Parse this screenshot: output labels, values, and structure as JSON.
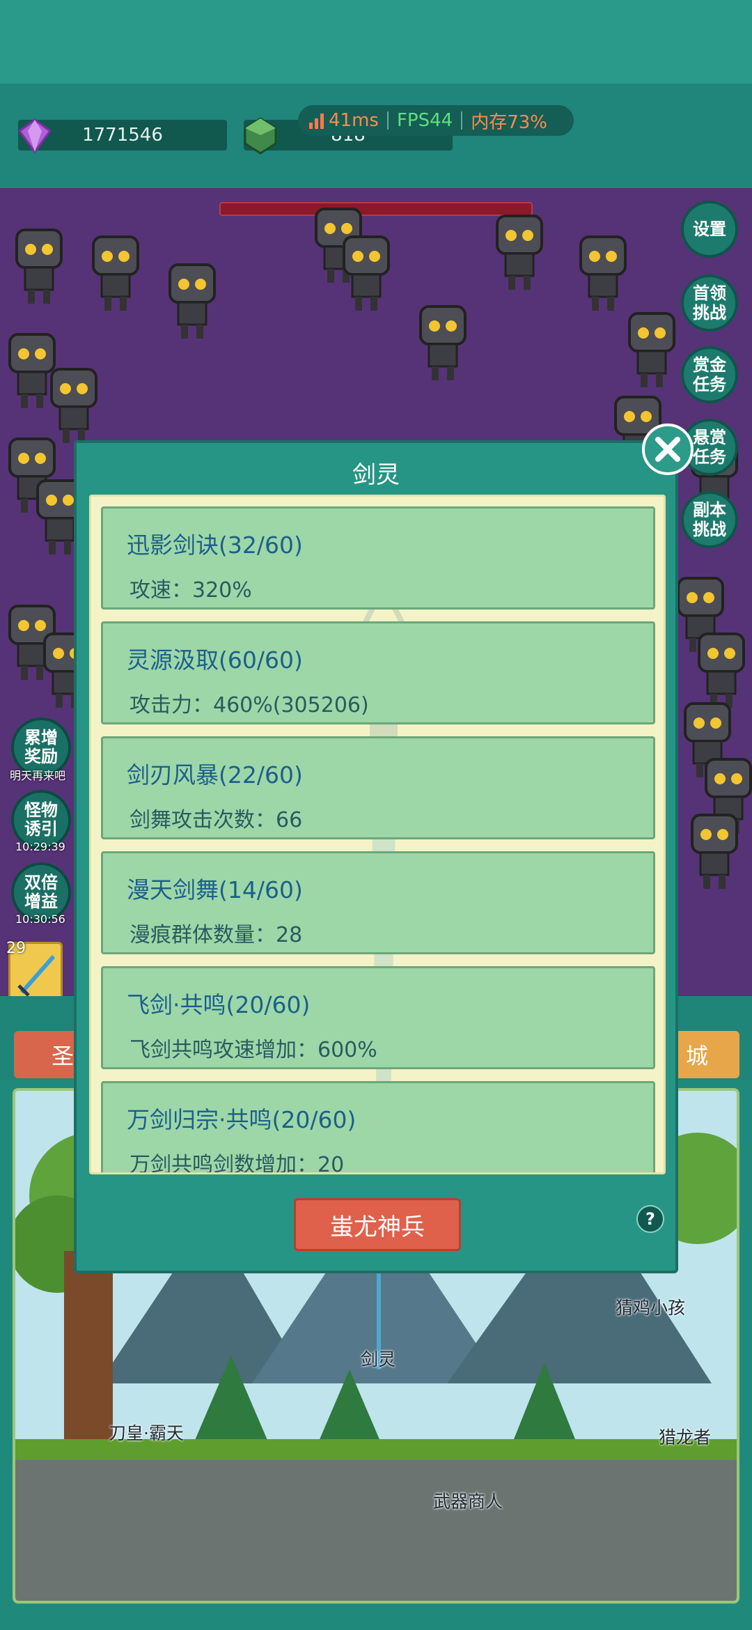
{
  "resources": {
    "gems": "1771546",
    "ore": "818"
  },
  "perf": {
    "latency": "41ms",
    "fps": "FPS44",
    "memory": "内存73%"
  },
  "right_menu": [
    "设置",
    "首领\n挑战",
    "赏金\n任务",
    "悬赏\n任务",
    "副本\n挑战"
  ],
  "left_menu": [
    {
      "label": "累增\n奖励",
      "note": "明天再来吧"
    },
    {
      "label": "怪物\n诱引",
      "note": "10:29:39"
    },
    {
      "label": "双倍\n增益",
      "note": "10:30:56"
    }
  ],
  "slot_level": "29",
  "shop": {
    "left_label": "圣",
    "right_label": "城"
  },
  "modal": {
    "title": "剑灵",
    "skills": [
      {
        "name": "迅影剑诀(32/60)",
        "desc": "攻速：320%"
      },
      {
        "name": "灵源汲取(60/60)",
        "desc": "攻击力：460%(305206)"
      },
      {
        "name": "剑刃风暴(22/60)",
        "desc": "剑舞攻击次数：66"
      },
      {
        "name": "漫天剑舞(14/60)",
        "desc": "漫痕群体数量：28"
      },
      {
        "name": "飞剑·共鸣(20/60)",
        "desc": "飞剑共鸣攻速增加：600%"
      },
      {
        "name": "万剑归宗·共鸣(20/60)",
        "desc": "万剑共鸣剑数增加：20"
      }
    ],
    "action_button": "蚩尤神兵",
    "help": "?"
  },
  "scene": {
    "npcs": [
      "刀皇·霸天",
      "剑灵",
      "武器商人",
      "猜鸡小孩",
      "猎龙者"
    ]
  },
  "colors": {
    "accent": "#279585",
    "card": "#9dd7a8",
    "button_red": "#e0614b",
    "battle_bg": "#563377"
  }
}
